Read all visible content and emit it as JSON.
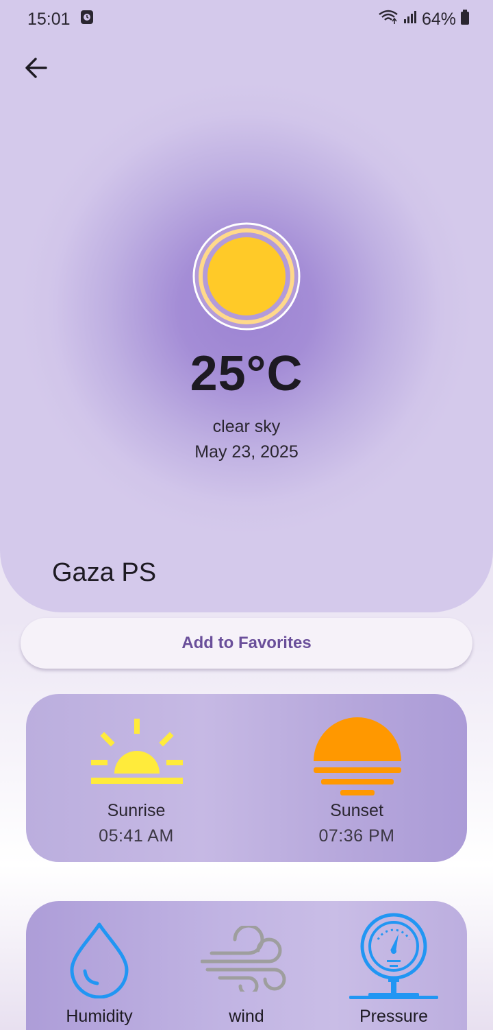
{
  "status": {
    "time": "15:01",
    "battery": "64%",
    "icons": [
      "wifi-icon",
      "signal-icon",
      "battery-icon"
    ]
  },
  "weather": {
    "temperature": "25°C",
    "description": "clear sky",
    "date": "May 23, 2025",
    "city": "Gaza PS",
    "icon": "sun-icon"
  },
  "actions": {
    "favorite_label": "Add to Favorites"
  },
  "sun": {
    "sunrise_label": "Sunrise",
    "sunrise_time": "05:41 AM",
    "sunset_label": "Sunset",
    "sunset_time": "07:36 PM"
  },
  "metrics": {
    "humidity_label": "Humidity",
    "wind_label": "wind",
    "pressure_label": "Pressure"
  },
  "colors": {
    "accent": "#6a4f9a",
    "sun": "#ffca28",
    "sunrise": "#ffeb3b",
    "sunset": "#ff9800",
    "humidity": "#2196f3",
    "wind": "#9e9e9e",
    "pressure": "#2196f3"
  }
}
